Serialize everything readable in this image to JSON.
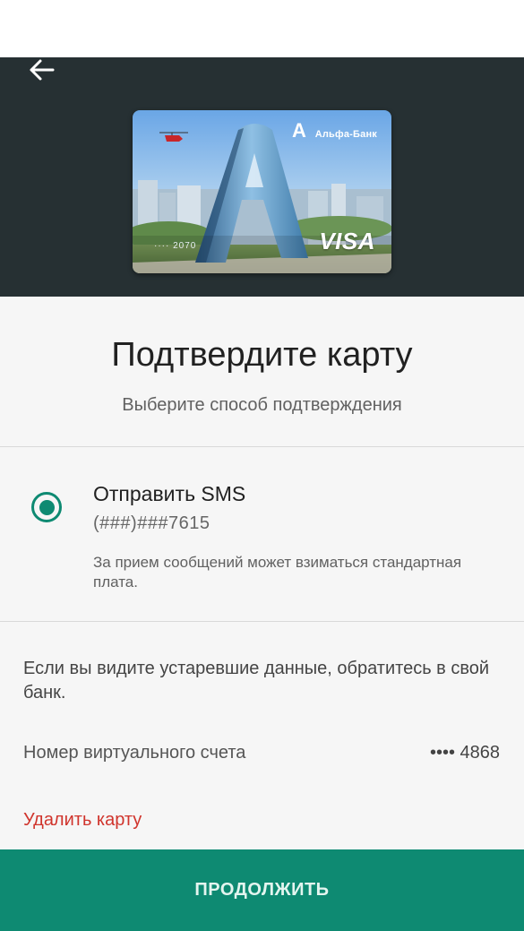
{
  "header": {
    "back_icon": "arrow-left-icon",
    "card": {
      "bank_logo": "А",
      "bank_name": "Альфа-Банк",
      "number_masked": "···· 2070",
      "network": "VISA"
    }
  },
  "confirm": {
    "title": "Подтвердите карту",
    "subtitle": "Выберите способ подтверждения"
  },
  "option": {
    "label": "Отправить SMS",
    "phone": "(###)###7615",
    "note": "За прием сообщений может взиматься стандартная плата.",
    "selected": true
  },
  "info": {
    "outdated_text": "Если вы видите устаревшие данные, обратитесь в свой банк.",
    "account_label": "Номер виртуального счета",
    "account_value": "•••• 4868"
  },
  "actions": {
    "delete_label": "Удалить карту",
    "continue_label": "ПРОДОЛЖИТЬ"
  },
  "colors": {
    "header_bg": "#263033",
    "accent": "#0e8a72",
    "danger": "#d0342c"
  }
}
